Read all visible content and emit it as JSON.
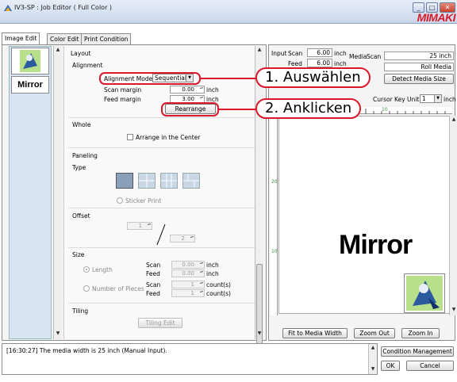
{
  "window": {
    "title": "IV3-SP : Job Editor ( Full Color )",
    "logo": "MIMAKI",
    "minimize": "_",
    "maximize": "□",
    "close": "✕"
  },
  "tabs": [
    {
      "label": "Image Edit",
      "active": true
    },
    {
      "label": "Color Edit",
      "active": false
    },
    {
      "label": "Print Condition",
      "active": false
    }
  ],
  "thumbnails": [
    {
      "label": ""
    },
    {
      "label": "Mirror"
    }
  ],
  "layout": {
    "heading": "Layout",
    "alignment": {
      "heading": "Alignment",
      "mode_label": "Alignment Mode",
      "mode_value": "Sequential",
      "scan_margin_label": "Scan margin",
      "scan_margin_value": "0.00",
      "feed_margin_label": "Feed margin",
      "feed_margin_value": "3.00",
      "unit": "inch",
      "rearrange_label": "Rearrange"
    },
    "whole": {
      "heading": "Whole",
      "center_label": "Arrange in the Center",
      "center_checked": false
    },
    "paneling": {
      "heading": "Paneling",
      "type_label": "Type",
      "sticker_label": "Sticker Print",
      "offset_label": "Offset",
      "offset_top": "1",
      "offset_bottom": "2"
    },
    "size": {
      "heading": "Size",
      "length_label": "Length",
      "pieces_label": "Number of Pieces",
      "scan_label": "Scan",
      "feed_label": "Feed",
      "length_scan": "0.00",
      "length_feed": "0.00",
      "pieces_scan": "1",
      "pieces_feed": "1",
      "inch": "inch",
      "count": "count(s)"
    },
    "tiling": {
      "heading": "Tiling",
      "edit_label": "Tiling Edit"
    }
  },
  "preview": {
    "input_label": "Input",
    "scan_label": "Scan",
    "scan_value": "6.00",
    "feed_label": "Feed",
    "feed_value": "6.00",
    "unit": "inch",
    "media_label": "Media",
    "media_scan_label": "Scan",
    "media_scan_value": "25 inch",
    "media_type": "Roll Media",
    "detect_label": "Detect Media Size",
    "cursor_key_label": "Cursor Key Unit",
    "cursor_key_value": "1",
    "cursor_unit": "inch",
    "ruler_top_label": "10",
    "ruler_left_labels": [
      "20",
      "10"
    ],
    "canvas_text": "Mirror",
    "fit_label": "Fit to Media Width",
    "zoom_out_label": "Zoom Out",
    "zoom_in_label": "Zoom In"
  },
  "log": {
    "message": "[16:30:27] The media width is 25 inch (Manual Input)."
  },
  "actions": {
    "condition_label": "Condition Management",
    "ok_label": "OK",
    "cancel_label": "Cancel"
  },
  "callouts": {
    "step1": "1. Auswählen",
    "step2": "2. Anklicken"
  },
  "colors": {
    "accent": "#d8192b",
    "ruler_text": "#3a8f3a"
  }
}
